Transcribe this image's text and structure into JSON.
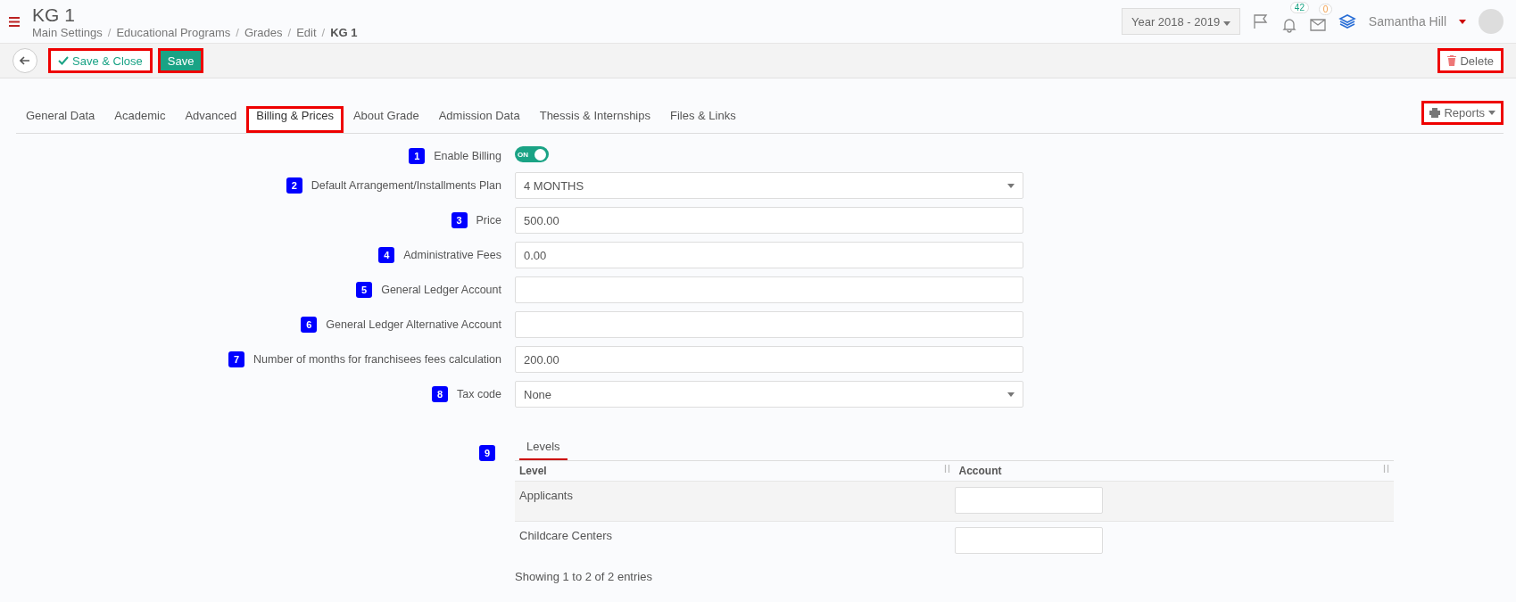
{
  "header": {
    "title": "KG 1",
    "breadcrumb": [
      {
        "label": "Main Settings",
        "current": false
      },
      {
        "label": "Educational Programs",
        "current": false
      },
      {
        "label": "Grades",
        "current": false
      },
      {
        "label": "Edit",
        "current": false
      },
      {
        "label": "KG 1",
        "current": true
      }
    ],
    "separator": "/",
    "year": "Year 2018 - 2019",
    "notifications": "42",
    "messages": "0",
    "user": "Samantha Hill"
  },
  "toolbar": {
    "buttons": [
      {
        "kind": "outline",
        "label": "Save & Close",
        "highlighted": true
      },
      {
        "kind": "primary",
        "label": "Save",
        "highlighted": true
      }
    ],
    "delete": {
      "label": "Delete",
      "highlighted": true
    }
  },
  "tabs": [
    {
      "label": "General Data",
      "selected": false,
      "highlighted": false
    },
    {
      "label": "Academic",
      "selected": false,
      "highlighted": false
    },
    {
      "label": "Advanced",
      "selected": false,
      "highlighted": false
    },
    {
      "label": "Billing & Prices",
      "selected": true,
      "highlighted": true
    },
    {
      "label": "About Grade",
      "selected": false,
      "highlighted": false
    },
    {
      "label": "Admission Data",
      "selected": false,
      "highlighted": false
    },
    {
      "label": "Thessis & Internships",
      "selected": false,
      "highlighted": false
    },
    {
      "label": "Files & Links",
      "selected": false,
      "highlighted": false
    }
  ],
  "reports": {
    "label": "Reports",
    "highlighted": true
  },
  "form": [
    {
      "badge": "1",
      "label": "Enable Billing",
      "kind": "toggle",
      "on": true,
      "toggle_text": "ON"
    },
    {
      "badge": "2",
      "label": "Default Arrangement/Installments Plan",
      "kind": "select",
      "value": "4 MONTHS"
    },
    {
      "badge": "3",
      "label": "Price",
      "kind": "input",
      "value": "500.00"
    },
    {
      "badge": "4",
      "label": "Administrative Fees",
      "kind": "input",
      "value": "0.00"
    },
    {
      "badge": "5",
      "label": "General Ledger Account",
      "kind": "input"
    },
    {
      "badge": "6",
      "label": "General Ledger Alternative Account",
      "kind": "input"
    },
    {
      "badge": "7",
      "label": "Number of months for franchisees fees calculation",
      "kind": "input",
      "value": "200.00"
    },
    {
      "badge": "8",
      "label": "Tax code",
      "kind": "select",
      "value": "None"
    }
  ],
  "levels": {
    "badge": "9",
    "tab": "Levels",
    "columns": [
      "Level",
      "Account"
    ],
    "rows": [
      {
        "level": "Applicants"
      },
      {
        "level": "Childcare Centers"
      }
    ],
    "footer": "Showing 1 to 2 of 2 entries"
  }
}
